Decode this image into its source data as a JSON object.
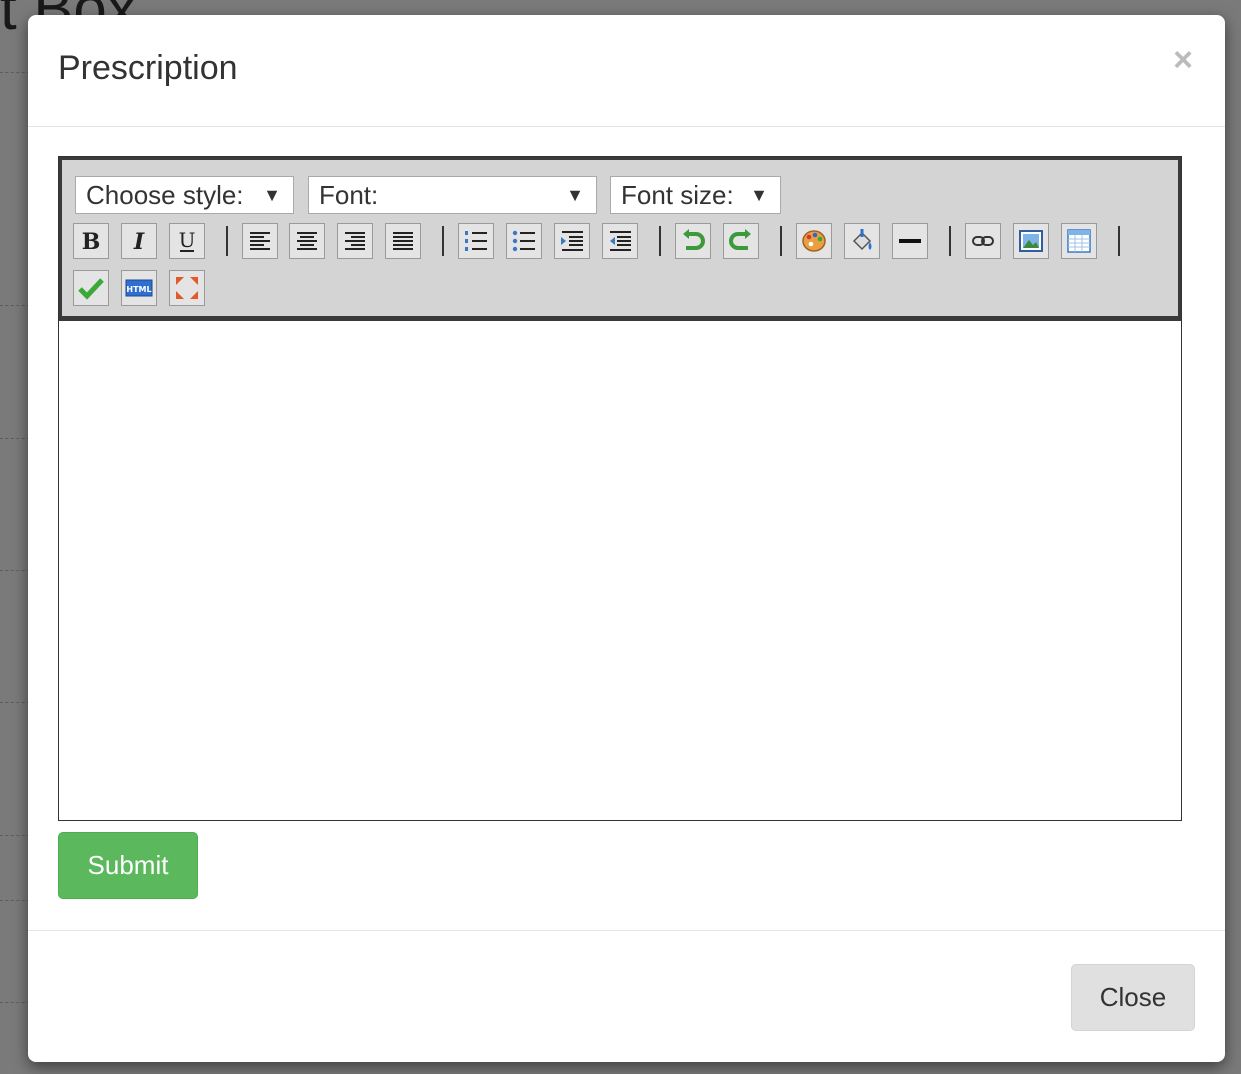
{
  "background": {
    "heading": "t Box"
  },
  "modal": {
    "title": "Prescription",
    "close_symbol": "×"
  },
  "toolbar": {
    "style_select": "Choose style:",
    "font_select": "Font:",
    "size_select": "Font size:",
    "dropdown_arrow": "▼",
    "buttons": [
      {
        "name": "bold-button",
        "icon": "bold-icon",
        "glyph": "B"
      },
      {
        "name": "italic-button",
        "icon": "italic-icon",
        "glyph": "I"
      },
      {
        "name": "underline-button",
        "icon": "underline-icon",
        "glyph": "U"
      },
      {
        "name": "align-left-button",
        "icon": "align-left-icon"
      },
      {
        "name": "align-center-button",
        "icon": "align-center-icon"
      },
      {
        "name": "align-right-button",
        "icon": "align-right-icon"
      },
      {
        "name": "align-justify-button",
        "icon": "align-justify-icon"
      },
      {
        "name": "ordered-list-button",
        "icon": "ordered-list-icon"
      },
      {
        "name": "unordered-list-button",
        "icon": "unordered-list-icon"
      },
      {
        "name": "indent-button",
        "icon": "indent-icon"
      },
      {
        "name": "outdent-button",
        "icon": "outdent-icon"
      },
      {
        "name": "undo-button",
        "icon": "undo-icon"
      },
      {
        "name": "redo-button",
        "icon": "redo-icon"
      },
      {
        "name": "text-color-button",
        "icon": "palette-icon"
      },
      {
        "name": "background-color-button",
        "icon": "paint-bucket-icon"
      },
      {
        "name": "horizontal-rule-button",
        "icon": "horizontal-rule-icon"
      },
      {
        "name": "link-button",
        "icon": "link-icon"
      },
      {
        "name": "image-button",
        "icon": "image-icon"
      },
      {
        "name": "table-button",
        "icon": "table-icon"
      },
      {
        "name": "save-button",
        "icon": "checkmark-icon"
      },
      {
        "name": "html-source-button",
        "icon": "html-icon",
        "glyph": "HTML"
      },
      {
        "name": "fullscreen-button",
        "icon": "fullscreen-icon"
      }
    ]
  },
  "actions": {
    "submit_label": "Submit",
    "close_label": "Close"
  },
  "colors": {
    "submit": "#5cb85c",
    "toolbar_bg": "#d4d4d4"
  }
}
